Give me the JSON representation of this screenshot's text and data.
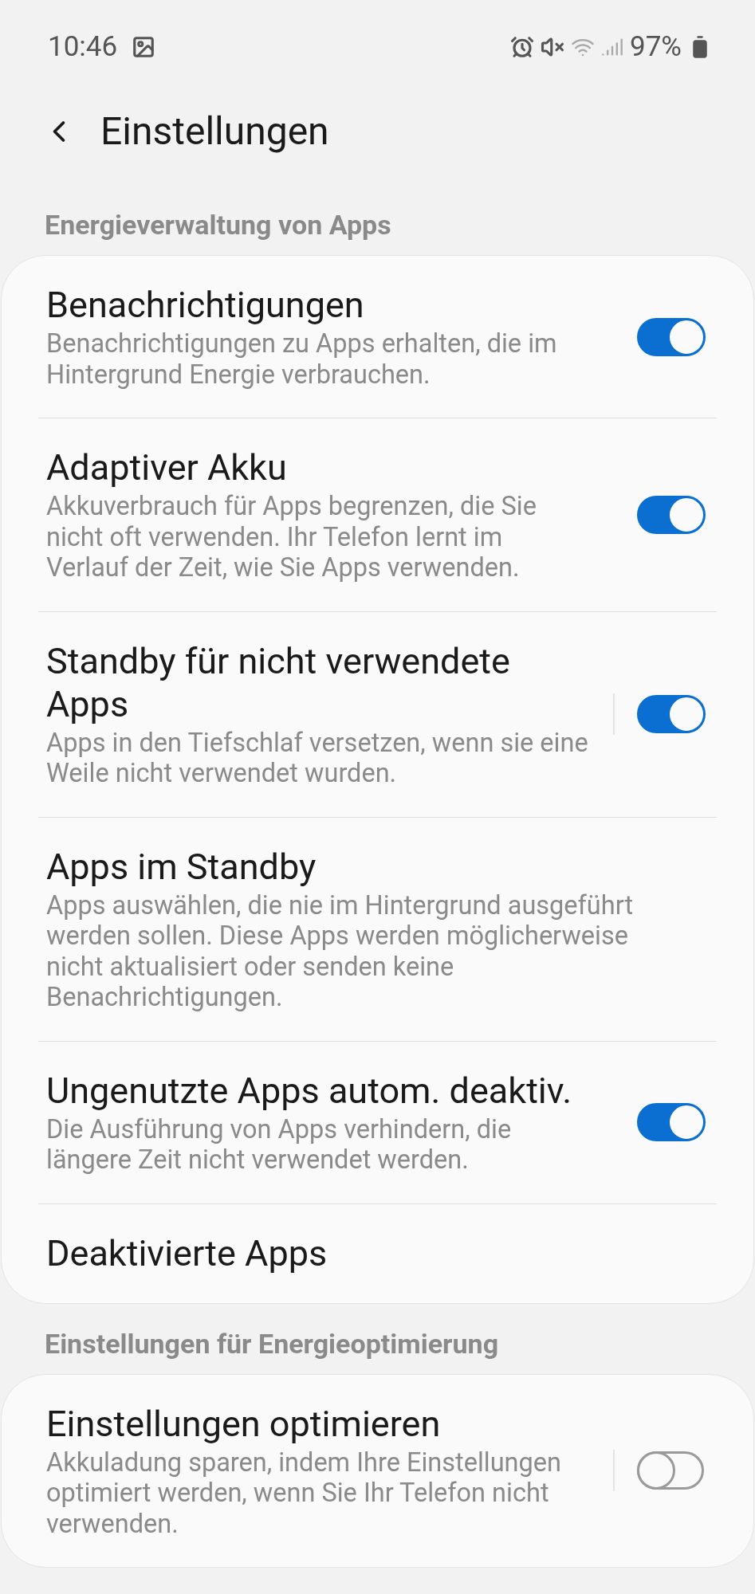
{
  "status_bar": {
    "time": "10:46",
    "battery": "97%"
  },
  "header": {
    "title": "Einstellungen"
  },
  "sections": [
    {
      "title": "Energieverwaltung von Apps",
      "items": [
        {
          "kind": "toggle",
          "title": "Benachrichtigungen",
          "subtitle": "Benachrichtigungen zu Apps erhalten, die im Hintergrund Energie verbrauchen.",
          "on": true
        },
        {
          "kind": "toggle",
          "title": "Adaptiver Akku",
          "subtitle": "Akkuverbrauch für Apps begrenzen, die Sie nicht oft verwenden. Ihr Telefon lernt im Verlauf der Zeit, wie Sie Apps verwenden.",
          "on": true
        },
        {
          "kind": "toggle",
          "title": "Standby für nicht verwendete Apps",
          "subtitle": "Apps in den Tiefschlaf versetzen, wenn sie eine Weile nicht verwendet wurden.",
          "on": true,
          "split": true
        },
        {
          "kind": "link",
          "title": "Apps im Standby",
          "subtitle": "Apps auswählen, die nie im Hintergrund ausgeführt werden sollen. Diese Apps werden möglicherweise nicht aktualisiert oder senden keine Benachrichtigungen."
        },
        {
          "kind": "toggle",
          "title": "Ungenutzte Apps autom. deaktiv.",
          "subtitle": "Die Ausführung von Apps verhindern, die längere Zeit nicht verwendet werden.",
          "on": true
        },
        {
          "kind": "link",
          "title": "Deaktivierte Apps"
        }
      ]
    },
    {
      "title": "Einstellungen für Energieoptimierung",
      "items": [
        {
          "kind": "toggle",
          "title": "Einstellungen optimieren",
          "subtitle": "Akkuladung sparen, indem Ihre Einstellungen optimiert werden, wenn Sie Ihr Telefon nicht verwenden.",
          "on": false,
          "split": true
        }
      ]
    }
  ]
}
